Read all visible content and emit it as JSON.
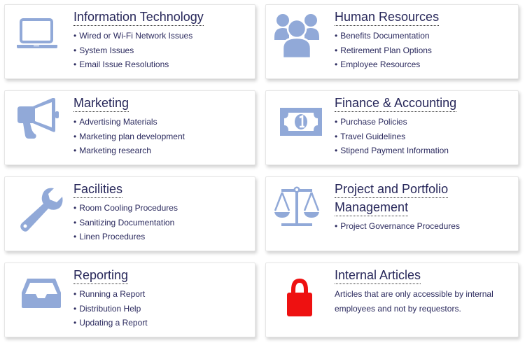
{
  "colors": {
    "icon": "#91a9d8",
    "lock": "#ee1111",
    "text": "#2b2a5e",
    "title": "#27275a"
  },
  "categories": [
    {
      "title": "Information Technology",
      "icon": "laptop-icon",
      "items": [
        "Wired or Wi-Fi Network Issues",
        "System Issues",
        "Email Issue Resolutions"
      ]
    },
    {
      "title": "Human Resources",
      "icon": "users-icon",
      "items": [
        "Benefits Documentation",
        "Retirement Plan Options",
        "Employee Resources"
      ]
    },
    {
      "title": "Marketing",
      "icon": "megaphone-icon",
      "items": [
        "Advertising Materials",
        "Marketing plan development",
        "Marketing research"
      ]
    },
    {
      "title": "Finance & Accounting",
      "icon": "money-bill-icon",
      "items": [
        "Purchase Policies",
        "Travel Guidelines",
        "Stipend Payment Information"
      ]
    },
    {
      "title": "Facilities",
      "icon": "wrench-icon",
      "items": [
        "Room Cooling Procedures",
        "Sanitizing Documentation",
        "Linen Procedures"
      ]
    },
    {
      "title_line1": "Project and Portfolio",
      "title_line2": "Management",
      "icon": "balance-scale-icon",
      "items": [
        "Project Governance Procedures"
      ]
    },
    {
      "title": "Reporting",
      "icon": "inbox-tray-icon",
      "items": [
        "Running a Report",
        "Distribution Help",
        "Updating a Report"
      ]
    },
    {
      "title": "Internal Articles",
      "icon": "lock-icon",
      "description": "Articles that are only accessible by internal employees and not by requestors."
    }
  ]
}
